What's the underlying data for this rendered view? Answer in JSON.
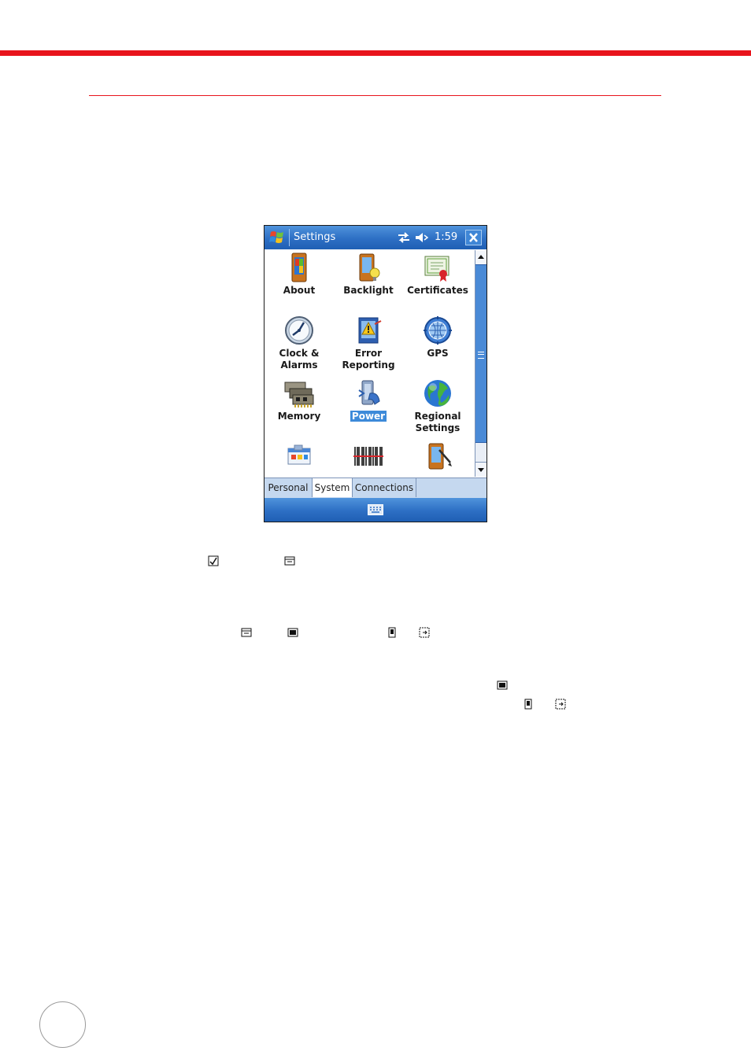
{
  "window": {
    "title": "Settings",
    "time": "1:59"
  },
  "icons": {
    "start": "windows-flag-icon",
    "sync": "sync-arrows-icon",
    "volume": "speaker-icon",
    "close": "close-icon",
    "keyboard": "keyboard-icon"
  },
  "items": [
    {
      "label": "About",
      "icon": "about-icon"
    },
    {
      "label": "Backlight",
      "icon": "backlight-icon"
    },
    {
      "label": "Certificates",
      "icon": "certificates-icon"
    },
    {
      "label": "Clock &",
      "label2": "Alarms",
      "icon": "clock-icon"
    },
    {
      "label": "Error",
      "label2": "Reporting",
      "icon": "error-reporting-icon"
    },
    {
      "label": "GPS",
      "icon": "gps-icon"
    },
    {
      "label": "Memory",
      "icon": "memory-icon"
    },
    {
      "label": "Power",
      "icon": "power-icon",
      "selected": true
    },
    {
      "label": "Regional",
      "label2": "Settings",
      "icon": "globe-icon"
    },
    {
      "label": "",
      "icon": "remove-programs-icon"
    },
    {
      "label": "",
      "icon": "barcode-icon"
    },
    {
      "label": "",
      "icon": "screen-icon"
    }
  ],
  "tabs": [
    {
      "label": "Personal"
    },
    {
      "label": "System",
      "active": true
    },
    {
      "label": "Connections"
    }
  ],
  "colors": {
    "accent": "#e8141c",
    "titlebar": "#2d6fc4",
    "selection": "#3d8ad9"
  }
}
